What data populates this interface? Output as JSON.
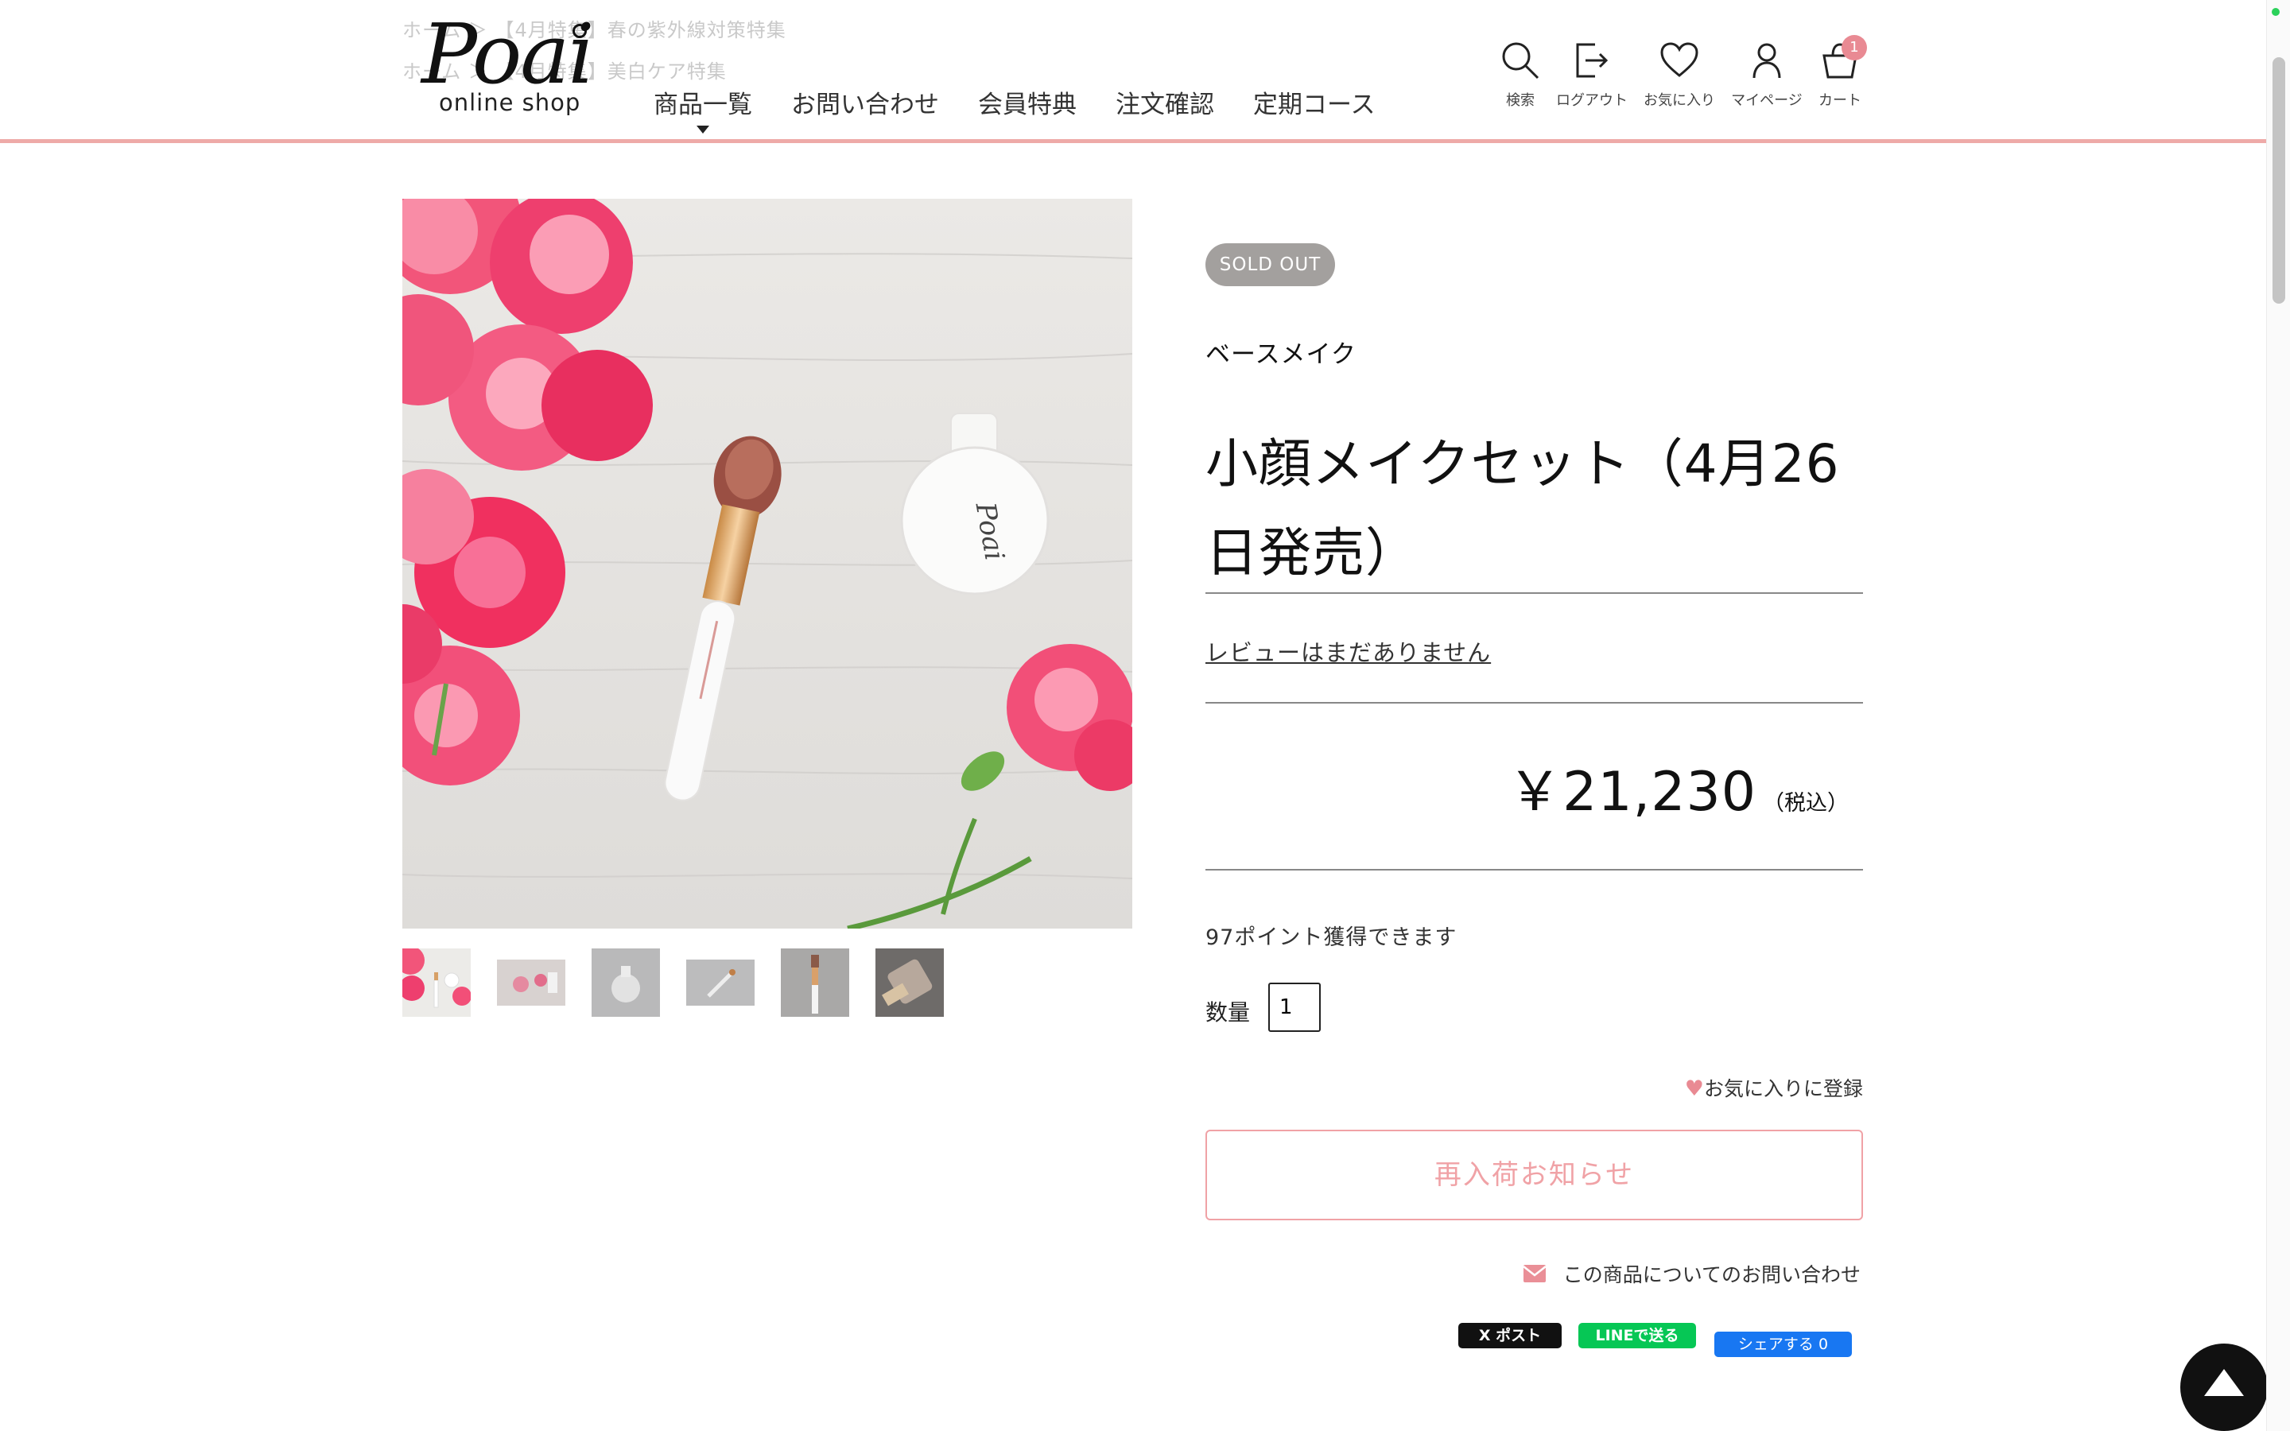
{
  "header": {
    "breadcrumbs": [
      "ホーム ＞ 【4月特集】春の紫外線対策特集",
      "ホーム ＞ 【4月特集】美白ケア特集"
    ],
    "logo_text": "Poai",
    "logo_sub": "online shop",
    "nav": [
      "商品一覧",
      "お問い合わせ",
      "会員特典",
      "注文確認",
      "定期コース"
    ],
    "icons": [
      {
        "name": "search-icon",
        "label": "検索"
      },
      {
        "name": "logout-icon",
        "label": "ログアウト"
      },
      {
        "name": "heart-icon",
        "label": "お気に入り"
      },
      {
        "name": "user-icon",
        "label": "マイページ"
      },
      {
        "name": "cart-icon",
        "label": "カート"
      }
    ],
    "cart_count": "1",
    "accent_color": "#eeaaa8"
  },
  "product": {
    "status_badge": "SOLD OUT",
    "category": "ベースメイク",
    "title": "小顔メイクセット（4月26日発売）",
    "reviews_link": "レビューはまだありません",
    "price": "￥21,230",
    "tax_note": "（税込）",
    "points": "97ポイント獲得できます",
    "quantity_label": "数量",
    "quantity_value": "1",
    "favorite_label": "お気に入りに登録",
    "restock_button": "再入荷お知らせ",
    "inquiry_link": "この商品についてのお問い合わせ",
    "thumbnail_count": 6
  },
  "share": {
    "x_label": "X ポスト",
    "line_label": "LINEで送る",
    "facebook_label": "シェアする 0"
  }
}
